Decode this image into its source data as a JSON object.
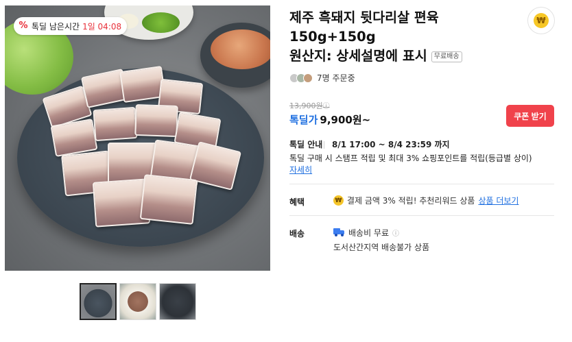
{
  "product_image": {
    "timer_badge": {
      "icon": "percent-icon",
      "label": "톡딜 남은시간",
      "time": "1일 04:08"
    }
  },
  "thumbnails": [
    "thumbnail-1",
    "thumbnail-2",
    "thumbnail-3"
  ],
  "product": {
    "title_lines": [
      "제주 흑돼지 뒷다리살 편육",
      "150g+150g",
      "원산지: 상세설명에 표시"
    ],
    "free_shipping_badge": "무료배송"
  },
  "buyers": {
    "count_text": "7명 주문중"
  },
  "price": {
    "original": "13,900원",
    "deal_label": "톡딜가",
    "deal_value": "9,900원~"
  },
  "coupon_button": "쿠폰 받기",
  "deal_info": {
    "label": "톡딜 안내",
    "period": "8/1 17:00 ~ 8/4 23:59 까지",
    "description": "톡딜 구매 시 스탬프 적립 및 최대 3% 쇼핑포인트를 적립(등급별 상이)",
    "more": "자세히"
  },
  "benefit": {
    "label": "혜택",
    "text": "결제 금액 3% 적립! 추천리워드 상품",
    "more": "상품 더보기"
  },
  "shipping": {
    "label": "배송",
    "fee": "배송비 무료",
    "note": "도서산간지역 배송불가 상품"
  },
  "colors": {
    "accent_blue": "#1f6fe0",
    "coupon_red": "#f0424b",
    "timer_red": "#e8303a"
  }
}
